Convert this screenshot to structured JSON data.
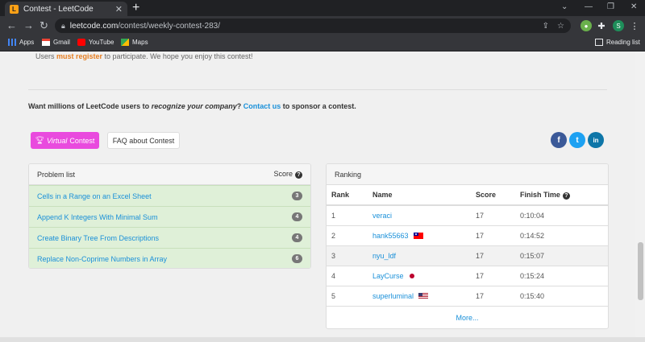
{
  "browser": {
    "tab_title": "Contest - LeetCode",
    "url_host": "leetcode.com",
    "url_path": "/contest/weekly-contest-283/",
    "profile_initial": "S",
    "bookmarks": [
      {
        "label": "Apps",
        "icon": "apps-grid-icon"
      },
      {
        "label": "Gmail",
        "icon": "gmail-icon"
      },
      {
        "label": "YouTube",
        "icon": "youtube-icon"
      },
      {
        "label": "Maps",
        "icon": "maps-icon"
      }
    ],
    "reading_list": "Reading list"
  },
  "intro": {
    "before": "Users ",
    "highlight": "must register",
    "after": " to participate. We hope you enjoy this contest!"
  },
  "sponsor": {
    "before": "Want millions of LeetCode users to ",
    "italic": "recognize your company",
    "mid": "? ",
    "link": "Contact us",
    "after": " to sponsor a contest."
  },
  "buttons": {
    "virtual_italic": "Virtual",
    "virtual_rest": "Contest",
    "faq": "FAQ about Contest"
  },
  "social": {
    "facebook": "f",
    "twitter": "t",
    "linkedin": "in"
  },
  "problem_list": {
    "title": "Problem list",
    "score_header": "Score",
    "items": [
      {
        "name": "Cells in a Range on an Excel Sheet",
        "score": "3"
      },
      {
        "name": "Append K Integers With Minimal Sum",
        "score": "4"
      },
      {
        "name": "Create Binary Tree From Descriptions",
        "score": "4"
      },
      {
        "name": "Replace Non-Coprime Numbers in Array",
        "score": "6"
      }
    ]
  },
  "ranking": {
    "title": "Ranking",
    "headers": {
      "rank": "Rank",
      "name": "Name",
      "score": "Score",
      "finish": "Finish Time"
    },
    "rows": [
      {
        "rank": "1",
        "name": "veraci",
        "score": "17",
        "finish": "0:10:04",
        "flag": ""
      },
      {
        "rank": "2",
        "name": "hank55663",
        "score": "17",
        "finish": "0:14:52",
        "flag": "taiwan-flag-icon"
      },
      {
        "rank": "3",
        "name": "nyu_ldf",
        "score": "17",
        "finish": "0:15:07",
        "flag": ""
      },
      {
        "rank": "4",
        "name": "LayCurse",
        "score": "17",
        "finish": "0:15:24",
        "flag": "japan-flag-icon"
      },
      {
        "rank": "5",
        "name": "superluminal",
        "score": "17",
        "finish": "0:15:40",
        "flag": "usa-flag-icon"
      }
    ],
    "more": "More..."
  },
  "colors": {
    "accent_link": "#1a90d9",
    "virtual_button": "#e94ade",
    "register": "#e67e22",
    "solved_row": "#dff0d8"
  }
}
